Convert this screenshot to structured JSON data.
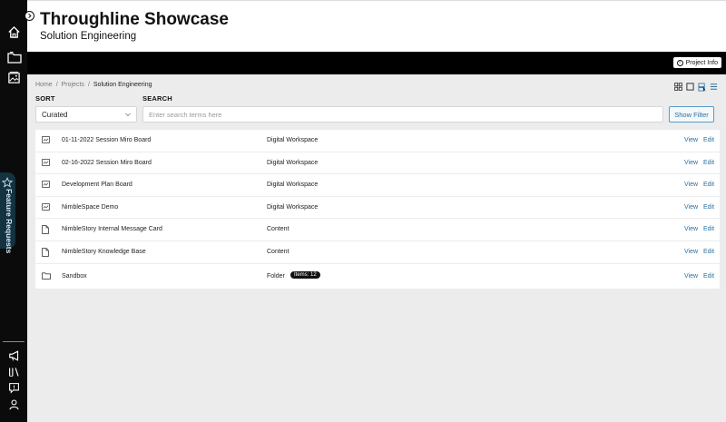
{
  "header": {
    "title": "Throughline Showcase",
    "subtitle": "Solution Engineering",
    "project_info_label": "Project Info"
  },
  "sidebar": {
    "feature_tab_label": "Feature Requests",
    "top_icons": [
      "home-icon",
      "folder-icon",
      "image-gallery-icon"
    ],
    "bottom_icons": [
      "megaphone-icon",
      "library-icon",
      "feedback-icon",
      "user-icon"
    ]
  },
  "breadcrumb": [
    "Home",
    "Projects",
    "Solution Engineering"
  ],
  "controls": {
    "sort_label": "SORT",
    "sort_value": "Curated",
    "search_label": "SEARCH",
    "search_placeholder": "Enter search terms here",
    "filter_button": "Show Filter"
  },
  "actions": {
    "view": "View",
    "edit": "Edit"
  },
  "items": [
    {
      "name": "01-11-2022 Session Miro Board",
      "type": "Digital Workspace",
      "icon": "workspace-icon"
    },
    {
      "name": "02-16-2022 Session Miro Board",
      "type": "Digital Workspace",
      "icon": "workspace-icon"
    },
    {
      "name": "Development Plan Board",
      "type": "Digital Workspace",
      "icon": "workspace-icon"
    },
    {
      "name": "NimbleSpace Demo",
      "type": "Digital Workspace",
      "icon": "workspace-icon"
    },
    {
      "name": "NimbleStory Internal Message Card",
      "type": "Content",
      "icon": "document-icon"
    },
    {
      "name": "NimbleStory Knowledge Base",
      "type": "Content",
      "icon": "document-icon"
    },
    {
      "name": "Sandbox",
      "type": "Folder",
      "icon": "folder-icon",
      "badge": "Items: 12"
    }
  ]
}
